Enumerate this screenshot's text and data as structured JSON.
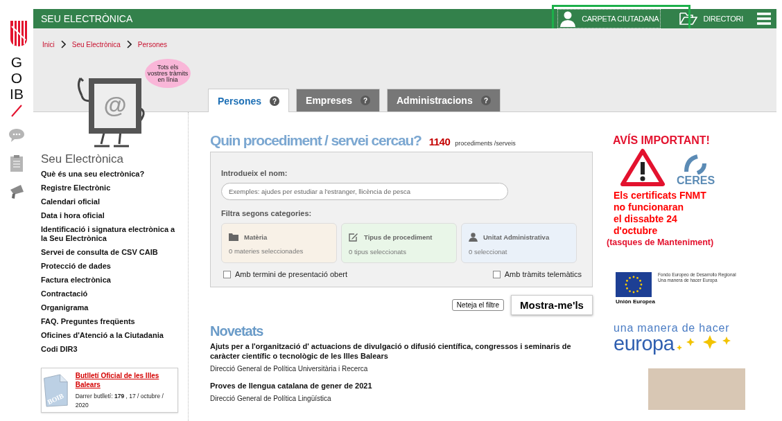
{
  "logo": {
    "text": "GOIB"
  },
  "header": {
    "title": "SEU ELECTRÒNICA",
    "links": [
      {
        "label": "CARPETA CIUTADANA",
        "kind": "person",
        "highlighted": true
      },
      {
        "label": "DIRECTORI",
        "kind": "folder",
        "highlighted": false
      }
    ]
  },
  "breadcrumb": [
    "Inici",
    "Seu Electrònica",
    "Persones"
  ],
  "mascot": {
    "screen_text": "@",
    "bubble": "Tots els vostres tràmits en línia"
  },
  "tabs": [
    {
      "label": "Persones",
      "help": "?",
      "selected": true
    },
    {
      "label": "Empreses",
      "help": "?",
      "selected": false
    },
    {
      "label": "Administracions",
      "help": "?",
      "selected": false
    }
  ],
  "sidebar": {
    "title": "Seu Electrònica",
    "items": [
      "Què és una seu electrònica?",
      "Registre Electrònic",
      "Calendari oficial",
      "Data i hora oficial",
      "Identificació i signatura electrònica a la Seu Electrònica",
      "Servei de consulta de CSV CAIB",
      "Protecció de dades",
      "Factura electrònica",
      "Contractació",
      "Organigrama",
      "FAQ. Preguntes freqüents",
      "Oficines d'Atenció a la Ciutadania",
      "Codi DIR3"
    ],
    "bulletin": {
      "badge": "BOIB",
      "title": "Butlletí Oficial de les Illes Balears",
      "text": "Darrer butlletí: **179** , 17 / octubre / 2020"
    }
  },
  "search": {
    "title": "Quin procediment / servei cercau?",
    "count": "1140",
    "count_label": "procediments /serveis",
    "name_label": "Introdueix el nom:",
    "placeholder": "Exemples: ajudes per estudiar a l'estranger, llicència de pesca",
    "filter_label": "Filtra segons categories:",
    "categories": [
      {
        "kind": "folder",
        "title": "Matèria",
        "summary": "0  materies seleccionades",
        "color": "#f8f1e7"
      },
      {
        "kind": "edit",
        "title": "Tipus de procediment",
        "summary": "0  tipus seleccionats",
        "color": "#e9f6e8"
      },
      {
        "kind": "person",
        "title": "Unitat Administrativa",
        "summary": "0  seleccionat",
        "color": "#eaf1f9"
      }
    ],
    "checkboxes": [
      {
        "label": "Amb termini de presentació obert",
        "checked": false
      },
      {
        "label": "Amb tràmits telemàtics",
        "checked": false
      }
    ],
    "clear_button": "Neteja el filtre",
    "submit_button": "Mostra-me'ls"
  },
  "news": {
    "title": "Novetats",
    "items": [
      {
        "title": "Ajuts per a l'organització d' actuacions de divulgació o difusió científica, congressos i seminaris de caràcter científic o tecnològic de les Illes Balears",
        "department": "Direcció General de Política Universitària i Recerca"
      },
      {
        "title": "Proves de llengua catalana de gener de 2021",
        "department": "Direcció General de Política Lingüística"
      }
    ]
  },
  "notice": {
    "heading": "AVÍS IMPORTANT!",
    "logo_text": "CERES",
    "lines": [
      "Els certificats FNMT",
      "no funcionaran",
      "el dissabte 24",
      "d'octubre"
    ],
    "note": "(tasques de Manteniment)"
  },
  "eu_logo": {
    "lines": [
      "Fondo Europeo de Desarrollo Regional",
      "Una manera de hacer Europa"
    ],
    "caption": "Unión Europea"
  },
  "slogan": {
    "line1": "una manera de hacer",
    "line2": "europa"
  }
}
